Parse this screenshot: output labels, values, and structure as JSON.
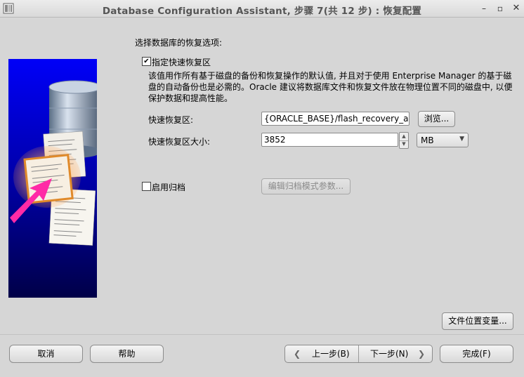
{
  "window": {
    "title": "Database Configuration Assistant, 步骤 7(共 12 步) : 恢复配置",
    "minimize_glyph": "–",
    "maximize_glyph": "▫",
    "close_glyph": "✕"
  },
  "form": {
    "section_label": "选择数据库的恢复选项:",
    "flash_recovery": {
      "checkbox_label": "指定快速恢复区",
      "checked": true,
      "description": "该值用作所有基于磁盘的备份和恢复操作的默认值, 并且对于使用 Enterprise Manager 的基于磁盘的自动备份也是必需的。Oracle 建议将数据库文件和恢复文件放在物理位置不同的磁盘中, 以便保护数据和提高性能。",
      "area_label": "快速恢复区:",
      "area_value": "{ORACLE_BASE}/flash_recovery_area",
      "browse_button": "浏览...",
      "size_label": "快速恢复区大小:",
      "size_value": "3852",
      "unit_value": "MB"
    },
    "archive": {
      "checkbox_label": "启用归档",
      "checked": false,
      "edit_button": "编辑归档模式参数..."
    },
    "file_location_button": "文件位置变量..."
  },
  "footer": {
    "cancel": "取消",
    "help": "帮助",
    "back": "上一步(B)",
    "next": "下一步(N)",
    "finish": "完成(F)"
  },
  "colors": {
    "panel_blue_top": "#0000ff",
    "panel_blue_bottom": "#000050",
    "accent_magenta": "#ff2aa6",
    "background": "#d6d6d6"
  }
}
